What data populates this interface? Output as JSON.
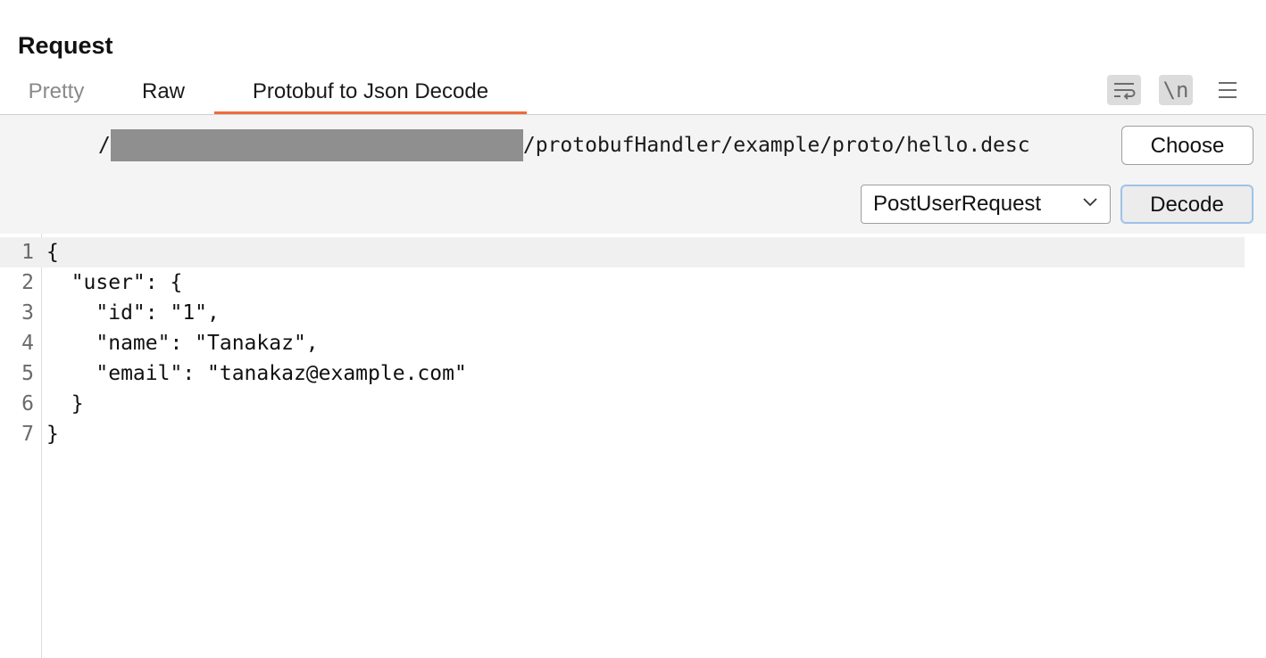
{
  "panel": {
    "title": "Request"
  },
  "tabs": [
    {
      "label": "Pretty",
      "active": false
    },
    {
      "label": "Raw",
      "active": false
    },
    {
      "label": "Protobuf to Json Decode",
      "active": true
    }
  ],
  "toolbar": {
    "wrap_icon": "word-wrap-icon",
    "newline_label": "\\n",
    "menu_icon": "hamburger-menu-icon"
  },
  "descriptor": {
    "path_prefix": "/",
    "path_suffix": "/protobufHandler/example/proto/hello.desc",
    "choose_label": "Choose"
  },
  "message_type": {
    "selected": "PostUserRequest"
  },
  "decode": {
    "label": "Decode"
  },
  "editor": {
    "lines": [
      {
        "num": "1",
        "text": "{"
      },
      {
        "num": "2",
        "text": "  \"user\": {"
      },
      {
        "num": "3",
        "text": "    \"id\": \"1\","
      },
      {
        "num": "4",
        "text": "    \"name\": \"Tanakaz\","
      },
      {
        "num": "5",
        "text": "    \"email\": \"tanakaz@example.com\""
      },
      {
        "num": "6",
        "text": "  }"
      },
      {
        "num": "7",
        "text": "}"
      }
    ]
  },
  "colors": {
    "active_tab_underline": "#f06b3c",
    "control_background": "#f4f4f4",
    "redaction": "#8f8f8f"
  }
}
